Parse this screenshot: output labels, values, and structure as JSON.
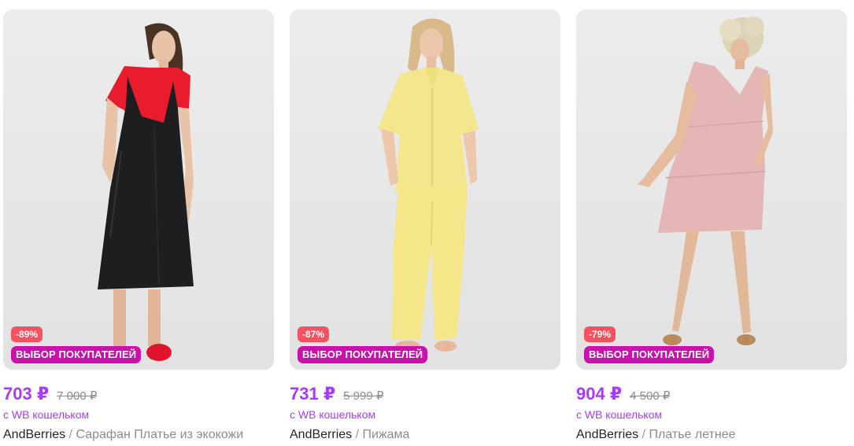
{
  "products": [
    {
      "photo": "Woman in black faux-leather midi slip dress over red t-shirt, red sneakers",
      "discount": "-89%",
      "choice_badge": "ВЫБОР ПОКУПАТЕЛЕЙ",
      "price": "703 ₽",
      "old_price": "7 000 ₽",
      "wallet_note": "с WB кошельком",
      "brand": "AndBerries",
      "separator": " / ",
      "name": "Сарафан Платье из экокожи"
    },
    {
      "photo": "Woman in yellow short-sleeve shirt and wide trousers pajama set",
      "discount": "-87%",
      "choice_badge": "ВЫБОР ПОКУПАТЕЛЕЙ",
      "price": "731 ₽",
      "old_price": "5 999 ₽",
      "wallet_note": "с WB кошельком",
      "brand": "AndBerries",
      "separator": " / ",
      "name": "Пижама"
    },
    {
      "photo": "Woman in short pink tiered summer dress with ruffled sleeves",
      "discount": "-79%",
      "choice_badge": "ВЫБОР ПОКУПАТЕЛЕЙ",
      "price": "904 ₽",
      "old_price": "4 500 ₽",
      "wallet_note": "с WB кошельком",
      "brand": "AndBerries",
      "separator": " / ",
      "name": "Платье летнее"
    }
  ],
  "colors": {
    "price": "#a73afd",
    "discount_badge": "#f5515f",
    "choice_badge": "#cb11ab"
  }
}
